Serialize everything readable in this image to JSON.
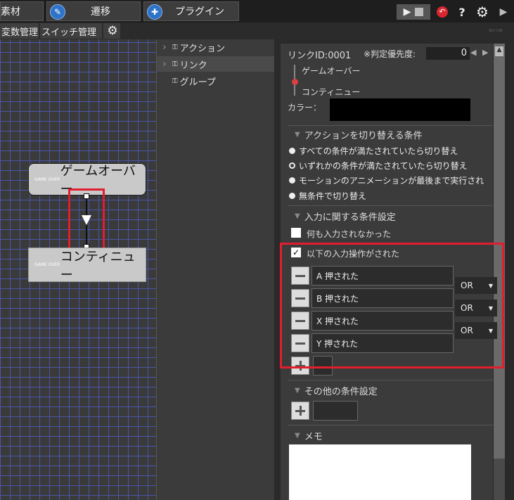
{
  "top_tabs": [
    {
      "label": "素材"
    },
    {
      "label": "遷移"
    },
    {
      "label": "プラグイン"
    }
  ],
  "sub_tabs": {
    "vars": "変数管理",
    "switch": "スイッチ管理"
  },
  "toolbar": {
    "help": "?"
  },
  "canvas": {
    "node1": {
      "tiny": "GAME OVER",
      "label": "ゲームオーバー"
    },
    "node2": {
      "tiny": "GAME OVER",
      "label": "コンティニュー"
    }
  },
  "tree": [
    {
      "label": "アクション"
    },
    {
      "label": "リンク"
    },
    {
      "label": "グループ"
    }
  ],
  "props": {
    "link_id": "リンクID:0001",
    "priority_label": "※判定優先度:",
    "priority_value": "0",
    "from": "ゲームオーバー",
    "to": "コンティニュー",
    "color_label": "カラー：",
    "color_value": "#000000",
    "switch_section": "アクションを切り替える条件",
    "radio_options": [
      "すべての条件が満たされていたら切り替え",
      "いずれかの条件が満たされていたら切り替え",
      "モーションのアニメーションが最後まで実行され",
      "無条件で切り替え"
    ],
    "selected_radio": 1,
    "input_section": "入力に関する条件設定",
    "no_input_label": "何も入力されなかった",
    "input_done_label": "以下の入力操作がされた",
    "inputs": [
      "A 押された",
      "B 押された",
      "X 押された",
      "Y 押された"
    ],
    "or_labels": [
      "OR",
      "OR",
      "OR"
    ],
    "other_section": "その他の条件設定",
    "memo_section": "メモ"
  },
  "colors": {
    "highlight": "#e01e2e",
    "accent": "#2f73c8"
  }
}
